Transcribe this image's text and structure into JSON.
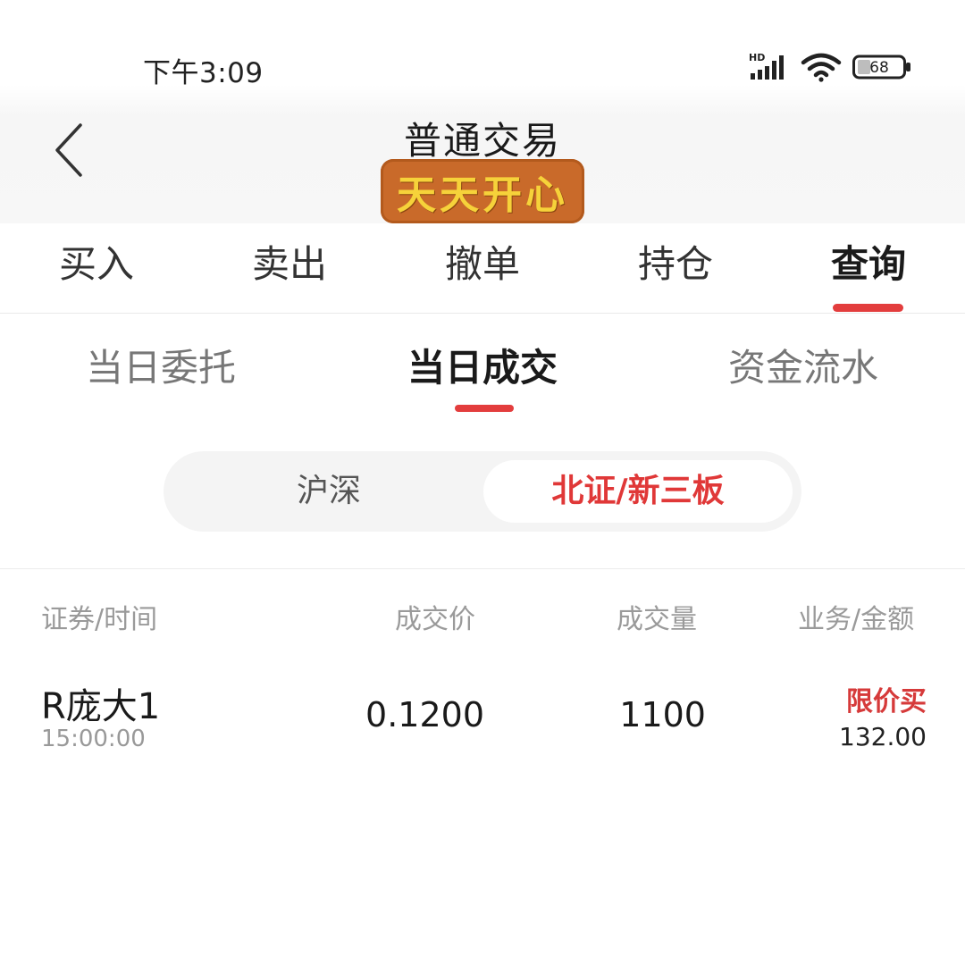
{
  "status_bar": {
    "time": "下午3:09",
    "signal_label": "HD",
    "battery": "68",
    "icons": [
      "signal-icon",
      "wifi-icon",
      "battery-icon"
    ]
  },
  "header": {
    "title": "普通交易",
    "sticker": "天天开心",
    "back_icon": "chevron-left-icon"
  },
  "main_tabs": [
    {
      "label": "买入"
    },
    {
      "label": "卖出"
    },
    {
      "label": "撤单"
    },
    {
      "label": "持仓"
    },
    {
      "label": "查询",
      "active": true
    }
  ],
  "sub_tabs": [
    {
      "label": "当日委托"
    },
    {
      "label": "当日成交",
      "active": true
    },
    {
      "label": "资金流水"
    }
  ],
  "market_segment": {
    "options": [
      "沪深",
      "北证/新三板"
    ],
    "selected": "北证/新三板"
  },
  "table": {
    "headers": [
      "证券/时间",
      "成交价",
      "成交量",
      "业务/金额"
    ],
    "rows": [
      {
        "name": "R庞大1",
        "time": "15:00:00",
        "price": "0.1200",
        "volume": "1100",
        "business": "限价买",
        "amount": "132.00"
      }
    ]
  },
  "colors": {
    "accent": "#e33d3d",
    "sticker_bg": "#c96a2a",
    "sticker_text": "#f6d23a"
  }
}
